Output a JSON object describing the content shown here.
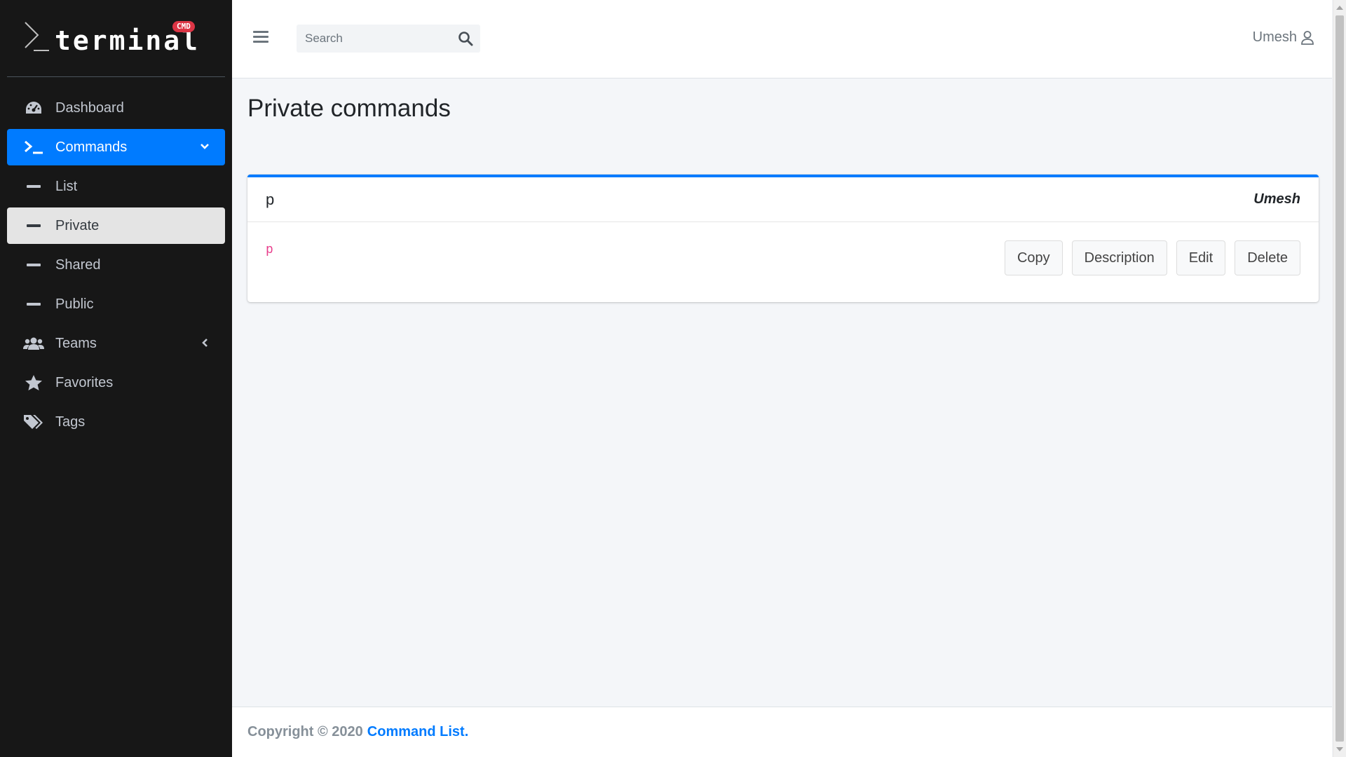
{
  "brand": {
    "name": "terminal",
    "badge": "CMD"
  },
  "sidebar": {
    "items": [
      {
        "label": "Dashboard",
        "icon": "tachometer-icon"
      },
      {
        "label": "Commands",
        "icon": "terminal-icon",
        "caret": "chevron-down-icon",
        "active": true
      },
      {
        "label": "List",
        "icon": "dash-icon"
      },
      {
        "label": "Private",
        "icon": "dash-icon",
        "selected": true
      },
      {
        "label": "Shared",
        "icon": "dash-icon"
      },
      {
        "label": "Public",
        "icon": "dash-icon"
      },
      {
        "label": "Teams",
        "icon": "users-icon",
        "caret": "chevron-left-icon"
      },
      {
        "label": "Favorites",
        "icon": "star-icon"
      },
      {
        "label": "Tags",
        "icon": "tags-icon"
      }
    ]
  },
  "topbar": {
    "search_placeholder": "Search",
    "user_name": "Umesh"
  },
  "page": {
    "title": "Private commands"
  },
  "command_card": {
    "title": "p",
    "owner": "Umesh",
    "command": "p",
    "buttons": {
      "copy": "Copy",
      "description": "Description",
      "edit": "Edit",
      "delete": "Delete"
    }
  },
  "footer": {
    "copyright": "Copyright © 2020",
    "link": "Command List",
    "suffix": "."
  },
  "colors": {
    "sidebar_bg": "#171717",
    "accent": "#007bff",
    "code": "#e83e8c"
  }
}
